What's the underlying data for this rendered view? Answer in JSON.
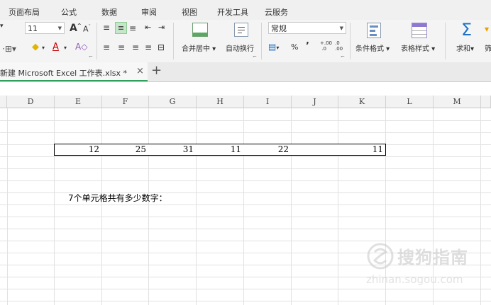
{
  "menu": [
    "页面布局",
    "公式",
    "数据",
    "审阅",
    "视图",
    "开发工具",
    "云服务"
  ],
  "ribbon": {
    "font_size": "11",
    "grow_font": "A",
    "shrink_font": "A",
    "font_color_glyph": "A",
    "merge_center": "合并居中",
    "wrap_text": "自动换行",
    "number_format": "常规",
    "percent": "%",
    "comma": "’",
    "dec_increase": ".00",
    "dec_decrease": ".00",
    "cond_format": "条件格式",
    "table_style": "表格样式",
    "sum": "求和",
    "filter_partial": "筛"
  },
  "file_tab": {
    "name": "新建 Microsoft Excel 工作表.xlsx *",
    "close": "×",
    "new_tab": "+"
  },
  "columns": [
    "D",
    "E",
    "F",
    "G",
    "H",
    "I",
    "J",
    "K",
    "L",
    "M"
  ],
  "row_values": [
    "12",
    "25",
    "31",
    "11",
    "22",
    "",
    "11"
  ],
  "question": "7个单元格共有多少数字：",
  "watermark": {
    "main": "搜狗指南",
    "sub": "zhinan.sogou.com"
  }
}
